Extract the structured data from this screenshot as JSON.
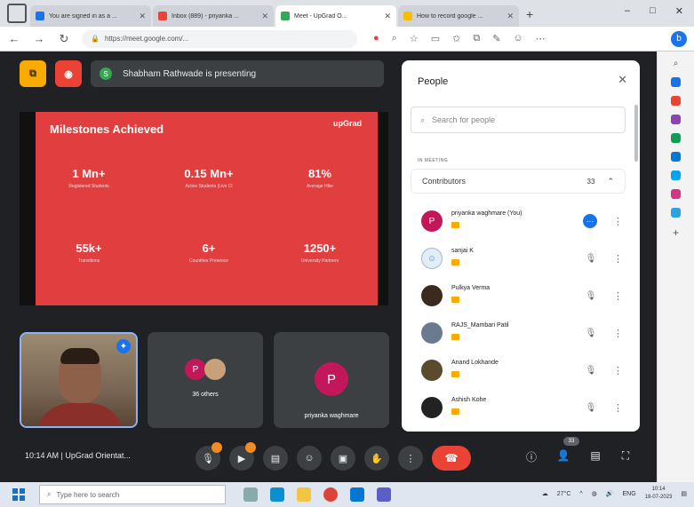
{
  "browser": {
    "tabs": [
      {
        "label": "You are signed in as a ...",
        "fav_color": "#1a73e8",
        "active": false
      },
      {
        "label": "Inbox (889) - priyanka ...",
        "fav_color": "#ea4335",
        "active": false
      },
      {
        "label": "Meet - UpGrad O...",
        "fav_color": "#34a853",
        "active": true
      },
      {
        "label": "How to record google ...",
        "fav_color": "#fbbc04",
        "active": false
      }
    ],
    "new_tab": "+",
    "url": "https://meet.google.com/...",
    "window_controls": [
      "–",
      "□",
      "✕"
    ]
  },
  "meet": {
    "presenting_initial": "S",
    "presenting_text": "Shabham Rathwade is presenting",
    "slide": {
      "title": "Milestones Achieved",
      "logo": "upGrad",
      "stats": [
        {
          "value": "1 Mn+",
          "label": "Registered Students"
        },
        {
          "value": "0.15 Mn+",
          "label": "Active Students (Live Cl"
        },
        {
          "value": "81%",
          "label": "Average Hike"
        },
        {
          "value": "55k+",
          "label": "Transitions"
        },
        {
          "value": "6+",
          "label": "Countries Presence"
        },
        {
          "value": "1250+",
          "label": "University Partners"
        }
      ]
    },
    "tiles": [
      {
        "label": "36 others"
      },
      {
        "avatar": "P",
        "label": "priyanka waghmare"
      }
    ],
    "meeting_info": "10:14 AM  |  UpGrad Orientat...",
    "raise_count": "33"
  },
  "people": {
    "title": "People",
    "search_placeholder": "Search for people",
    "section_label": "IN MEETING",
    "group_label": "Contributors",
    "group_count": "33",
    "participants": [
      {
        "name": "priyanka waghmare (You)",
        "avatar": "P",
        "color": "#c2185b",
        "mic_active": true
      },
      {
        "name": "sanjai K",
        "avatar": "",
        "color": "#e3edf7",
        "mic_active": false
      },
      {
        "name": "Pulkya Verma",
        "avatar": "",
        "color": "#3b2a20",
        "mic_active": false
      },
      {
        "name": "RAJS_Mambari Patil",
        "avatar": "",
        "color": "#6b7b8f",
        "mic_active": false
      },
      {
        "name": "Anand Lokhande",
        "avatar": "",
        "color": "#5a4a2e",
        "mic_active": false
      },
      {
        "name": "Ashish Kohe",
        "avatar": "",
        "color": "#222222",
        "mic_active": false
      }
    ]
  },
  "taskbar": {
    "search_placeholder": "Type here to search",
    "weather": "27°C",
    "lang": "ENG",
    "time": "10:14",
    "date": "18-07-2023"
  }
}
